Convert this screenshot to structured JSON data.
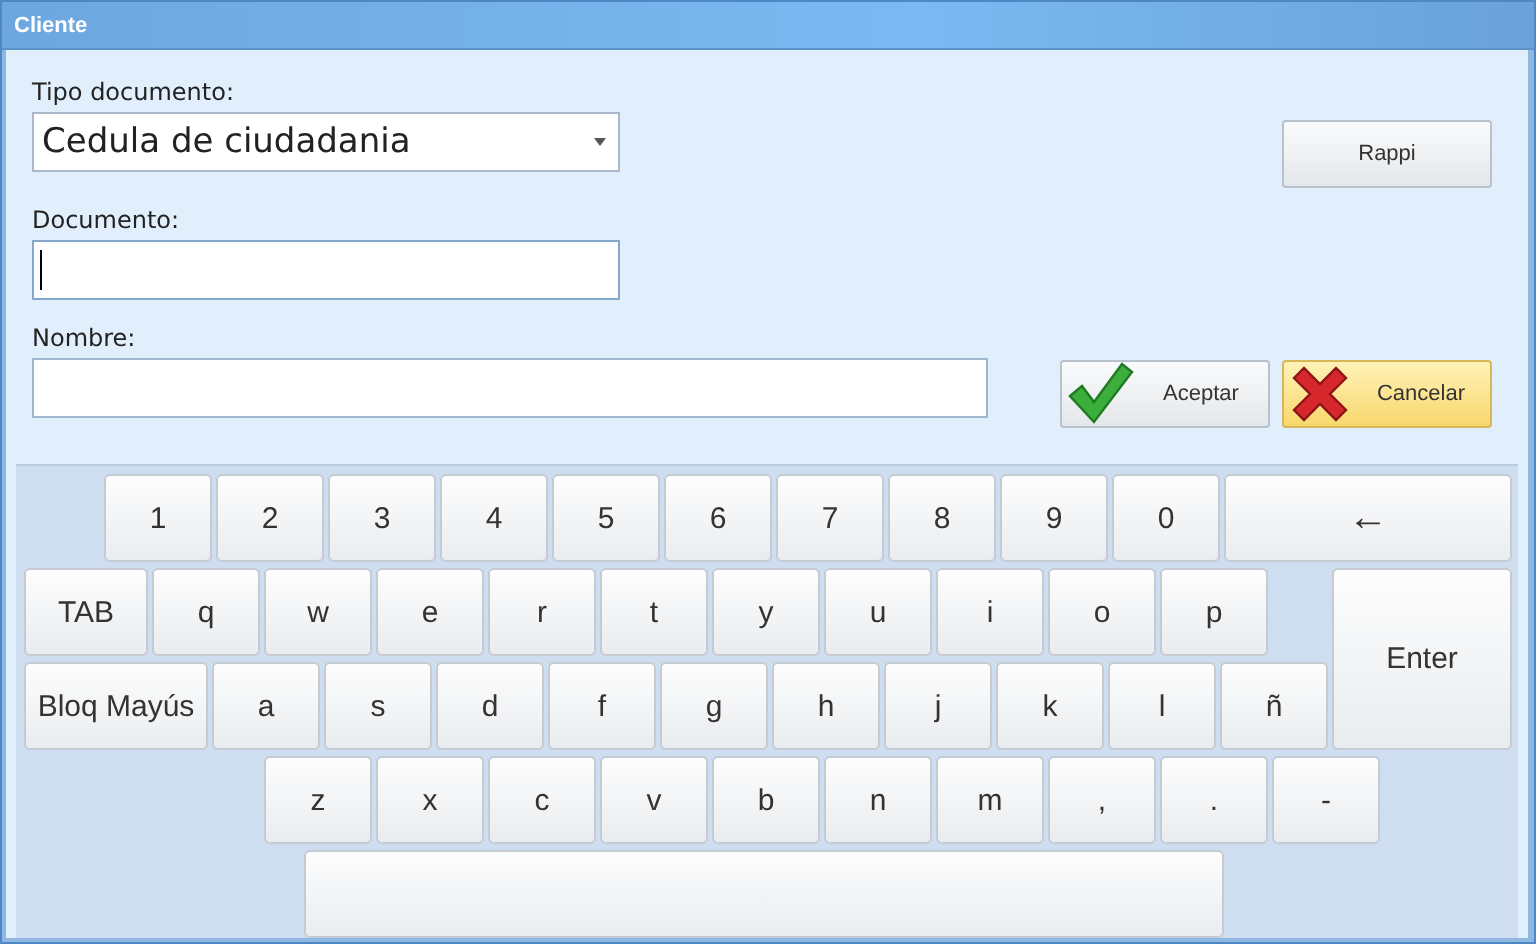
{
  "window": {
    "title": "Cliente"
  },
  "form": {
    "tipo_documento": {
      "label": "Tipo documento:",
      "value": "Cedula de ciudadania"
    },
    "documento": {
      "label": "Documento:",
      "focused": true
    },
    "nombre": {
      "label": "Nombre:",
      "focused": false
    }
  },
  "buttons": {
    "rappi": "Rappi",
    "aceptar": "Aceptar",
    "cancelar": "Cancelar"
  },
  "keyboard": {
    "row_1": [
      {
        "label": "1",
        "kind": "key"
      },
      {
        "label": "2",
        "kind": "key"
      },
      {
        "label": "3",
        "kind": "key"
      },
      {
        "label": "4",
        "kind": "key"
      },
      {
        "label": "5",
        "kind": "key"
      },
      {
        "label": "6",
        "kind": "key"
      },
      {
        "label": "7",
        "kind": "key"
      },
      {
        "label": "8",
        "kind": "key"
      },
      {
        "label": "9",
        "kind": "key"
      },
      {
        "label": "0",
        "kind": "key"
      },
      {
        "label": "←",
        "kind": "backspace"
      }
    ],
    "row_2": [
      {
        "label": "TAB",
        "kind": "tab"
      },
      {
        "label": "q",
        "kind": "key"
      },
      {
        "label": "w",
        "kind": "key"
      },
      {
        "label": "e",
        "kind": "key"
      },
      {
        "label": "r",
        "kind": "key"
      },
      {
        "label": "t",
        "kind": "key"
      },
      {
        "label": "y",
        "kind": "key"
      },
      {
        "label": "u",
        "kind": "key"
      },
      {
        "label": "i",
        "kind": "key"
      },
      {
        "label": "o",
        "kind": "key"
      },
      {
        "label": "p",
        "kind": "key"
      }
    ],
    "row_3": [
      {
        "label": "Bloq Mayús",
        "kind": "caps"
      },
      {
        "label": "a",
        "kind": "key"
      },
      {
        "label": "s",
        "kind": "key"
      },
      {
        "label": "d",
        "kind": "key"
      },
      {
        "label": "f",
        "kind": "key"
      },
      {
        "label": "g",
        "kind": "key"
      },
      {
        "label": "h",
        "kind": "key"
      },
      {
        "label": "j",
        "kind": "key"
      },
      {
        "label": "k",
        "kind": "key"
      },
      {
        "label": "l",
        "kind": "key"
      },
      {
        "label": "ñ",
        "kind": "key"
      }
    ],
    "enter_key": {
      "label": "Enter"
    },
    "row_4": [
      {
        "label": "z"
      },
      {
        "label": "x"
      },
      {
        "label": "c"
      },
      {
        "label": "v"
      },
      {
        "label": "b"
      },
      {
        "label": "n"
      },
      {
        "label": "m"
      },
      {
        "label": ","
      },
      {
        "label": "."
      },
      {
        "label": "-"
      }
    ]
  }
}
